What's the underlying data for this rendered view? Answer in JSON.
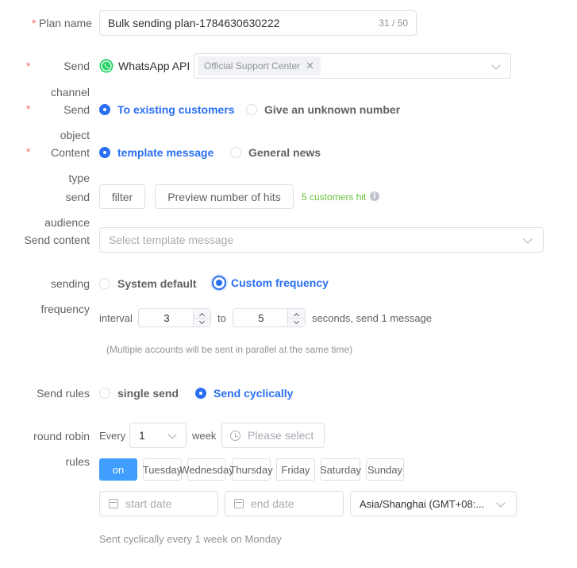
{
  "plan_name": {
    "label": "Plan name",
    "value": "Bulk sending plan-1784630630222",
    "counter": "31 / 50"
  },
  "send_channel": {
    "label_line1": "Send",
    "label_line2": "channel",
    "channel_name": "WhatsApp API",
    "selected_tag": "Official Support Center"
  },
  "send_object": {
    "label_line1": "Send",
    "label_line2": "object",
    "options": [
      "To existing customers",
      "Give an unknown number"
    ],
    "selected": 0
  },
  "content_type": {
    "label_line1": "Content",
    "label_line2": "type",
    "options": [
      "template message",
      "General news"
    ],
    "selected": 0
  },
  "send_audience": {
    "label_line1": "send",
    "label_line2": "audience",
    "filter_button": "filter",
    "preview_button": "Preview number of hits",
    "hit_text": "5 customers hit"
  },
  "send_content": {
    "label": "Send content",
    "placeholder": "Select template message"
  },
  "sending_frequency": {
    "label_line1": "sending",
    "label_line2": "frequency",
    "options": [
      "System default",
      "Custom frequency"
    ],
    "selected": 1,
    "interval_label": "interval",
    "from_value": "3",
    "to_label": "to",
    "to_value": "5",
    "suffix": "seconds, send 1 message",
    "note": "(Multiple accounts will be sent in parallel at the same time)"
  },
  "send_rules": {
    "label": "Send rules",
    "options": [
      "single send",
      "Send cyclically"
    ],
    "selected": 1
  },
  "round_robin": {
    "label_line1": "round robin",
    "label_line2": "rules",
    "every_label": "Every",
    "every_value": "1",
    "unit_label": "week",
    "time_placeholder": "Please select",
    "days": [
      "on",
      "Tuesday",
      "Wednesday",
      "Thursday",
      "Friday",
      "Saturday",
      "Sunday"
    ],
    "selected_day": 0,
    "start_placeholder": "start date",
    "end_placeholder": "end date",
    "timezone": "Asia/Shanghai (GMT+08:...",
    "summary": "Sent cyclically every 1 week on Monday"
  },
  "colors": {
    "primary": "#2a6ff0",
    "day_selected": "#409eff",
    "required": "#f56c6c",
    "hit_text": "#67c23a",
    "whatsapp": "#25d366"
  }
}
